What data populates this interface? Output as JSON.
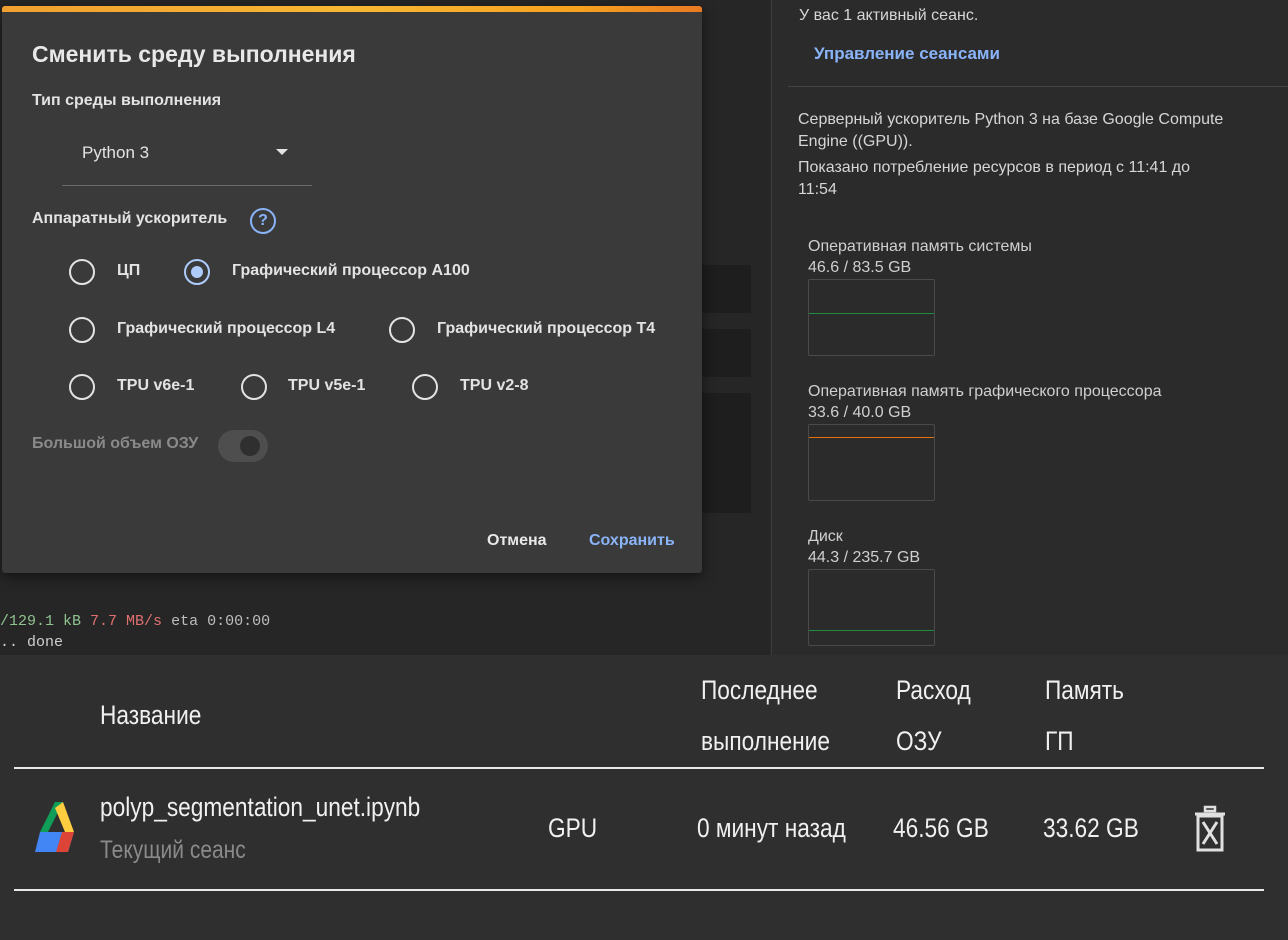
{
  "terminal": {
    "progress": "/129.1 kB",
    "speed": "7.7 MB/s",
    "eta_label": "eta",
    "eta_value": "0:00:00",
    "done_line": ".. done"
  },
  "dialog": {
    "title": "Сменить среду выполнения",
    "runtime_type_label": "Тип среды выполнения",
    "runtime_type_value": "Python 3",
    "accelerator_label": "Аппаратный ускоритель",
    "help_icon_glyph": "?",
    "accelerators": [
      {
        "label": "ЦП",
        "selected": false
      },
      {
        "label": "Графический процессор A100",
        "selected": true
      },
      {
        "label": "Графический процессор L4",
        "selected": false
      },
      {
        "label": "Графический процессор T4",
        "selected": false
      },
      {
        "label": "TPU v6e-1",
        "selected": false
      },
      {
        "label": "TPU v5e-1",
        "selected": false
      },
      {
        "label": "TPU v2-8",
        "selected": false
      }
    ],
    "high_ram_label": "Большой объем ОЗУ",
    "high_ram_enabled": false,
    "cancel_label": "Отмена",
    "save_label": "Сохранить",
    "accent_color": "#f7b733"
  },
  "resources": {
    "active_sessions": "У вас 1 активный сеанс.",
    "manage_sessions": "Управление сеансами",
    "backend_line1": "Серверный ускоритель Python 3 на базе Google Compute",
    "backend_line2": "Engine ((GPU)).",
    "period_line1": "Показано потребление ресурсов в период с 11:41 до",
    "period_line2": "11:54",
    "metrics": [
      {
        "label": "Оперативная память системы",
        "value": "46.6 / 83.5 GB",
        "line_color": "#1e8e3e"
      },
      {
        "label": "Оперативная память графического процессора",
        "value": "33.6 / 40.0 GB",
        "line_color": "#e8710a"
      },
      {
        "label": "Диск",
        "value": "44.3 / 235.7 GB",
        "line_color": "#1e8e3e"
      }
    ]
  },
  "sessions": {
    "headers": {
      "name": "Название",
      "last_exec_1": "Последнее",
      "last_exec_2": "выполнение",
      "ram_1": "Расход",
      "ram_2": "ОЗУ",
      "gpu_mem_1": "Память",
      "gpu_mem_2": "ГП"
    },
    "rows": [
      {
        "file": "polyp_segmentation_unet.ipynb",
        "subtitle": "Текущий сеанс",
        "type": "GPU",
        "last_exec": "0 минут назад",
        "ram": "46.56 GB",
        "gpu_mem": "33.62 GB",
        "icon": "google-drive-icon",
        "action_icon": "trash-icon"
      }
    ]
  }
}
